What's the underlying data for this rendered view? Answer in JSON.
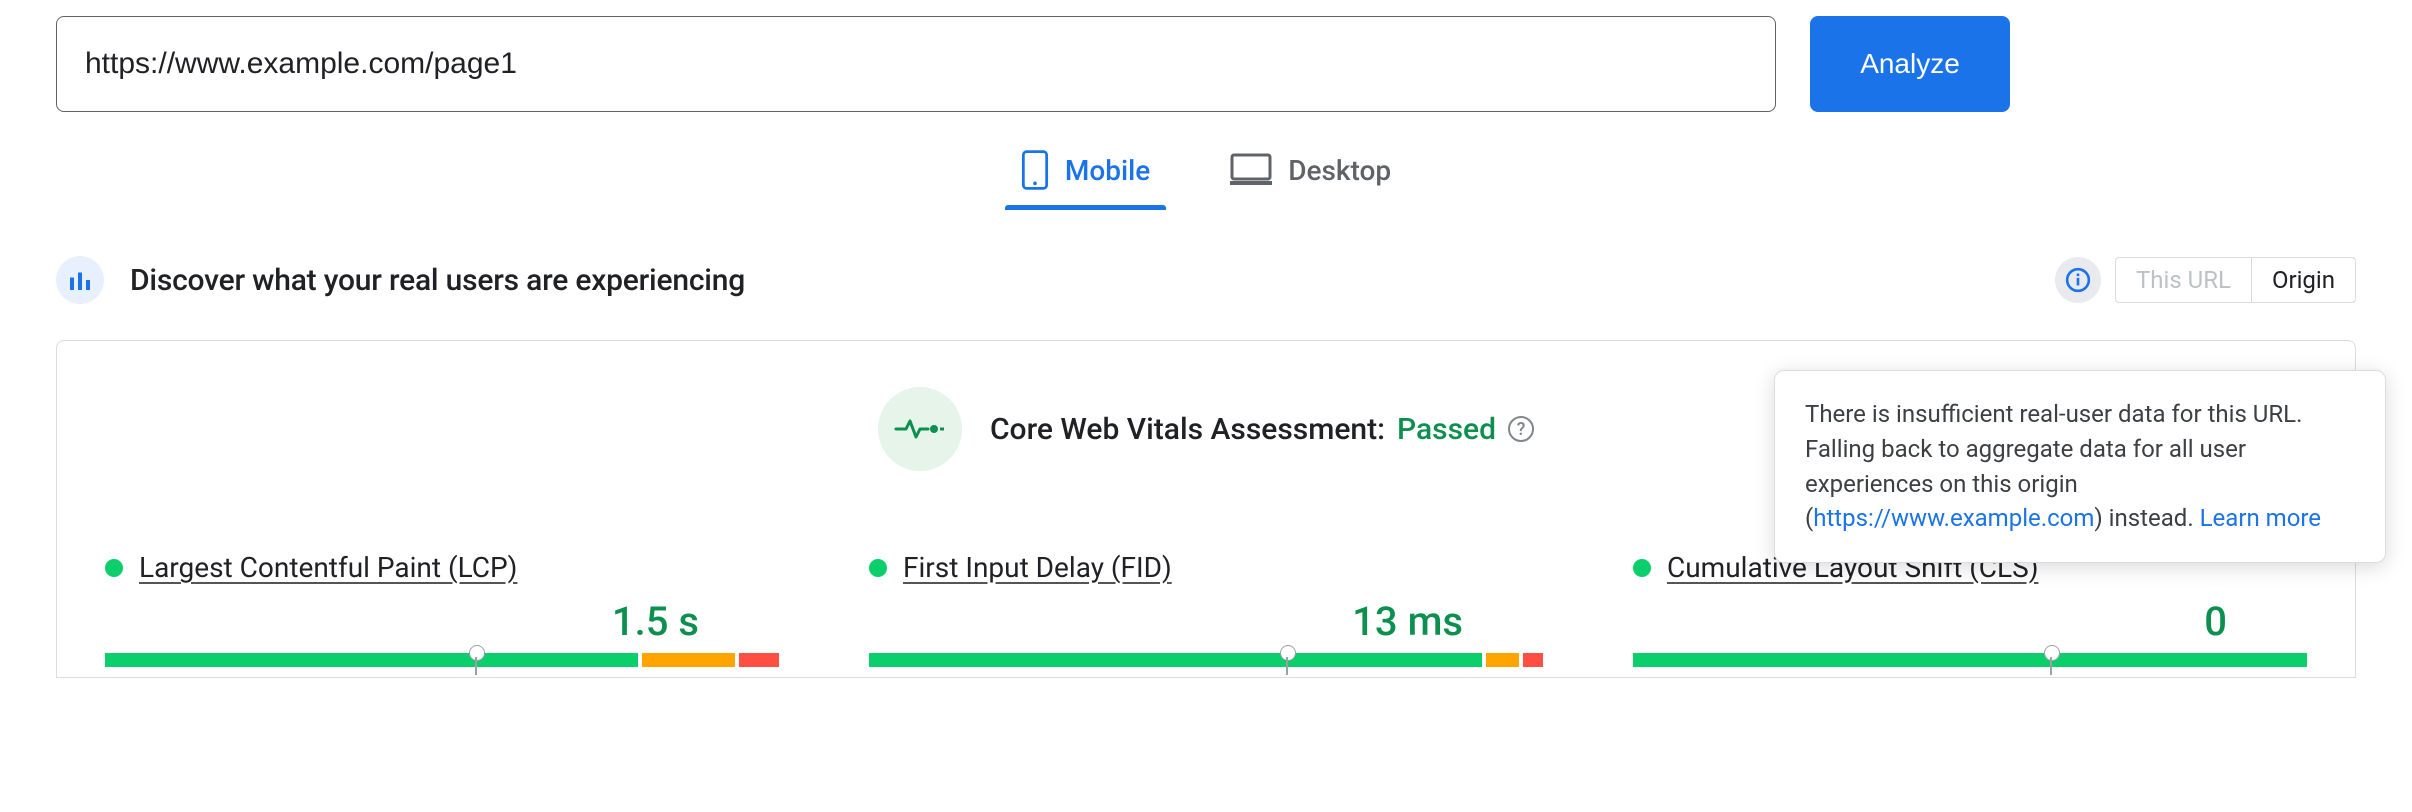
{
  "urlInput": {
    "value": "https://www.example.com/page1"
  },
  "buttons": {
    "analyze": "Analyze"
  },
  "tabs": {
    "mobile": "Mobile",
    "desktop": "Desktop"
  },
  "sectionTitle": "Discover what your real users are experiencing",
  "scopeToggle": {
    "thisUrl": "This URL",
    "origin": "Origin"
  },
  "assessment": {
    "prefix": "Core Web Vitals Assessment: ",
    "result": "Passed"
  },
  "metrics": [
    {
      "name": "Largest Contentful Paint (LCP)",
      "value": "1.5 s",
      "bar": {
        "g": 80,
        "o": 14,
        "r": 6
      },
      "marker": 55
    },
    {
      "name": "First Input Delay (FID)",
      "value": "13 ms",
      "bar": {
        "g": 92,
        "o": 5,
        "r": 3
      },
      "marker": 62
    },
    {
      "name": "Cumulative Layout Shift (CLS)",
      "value": "0",
      "bar": {
        "g": 100,
        "o": 0,
        "r": 0
      },
      "marker": 62
    }
  ],
  "tooltip": {
    "text1": "There is insufficient real-user data for this URL. Falling back to aggregate data for all user experiences on this origin (",
    "link1": "https://www.example.com",
    "text2": ") instead. ",
    "learnMore": "Learn more"
  }
}
